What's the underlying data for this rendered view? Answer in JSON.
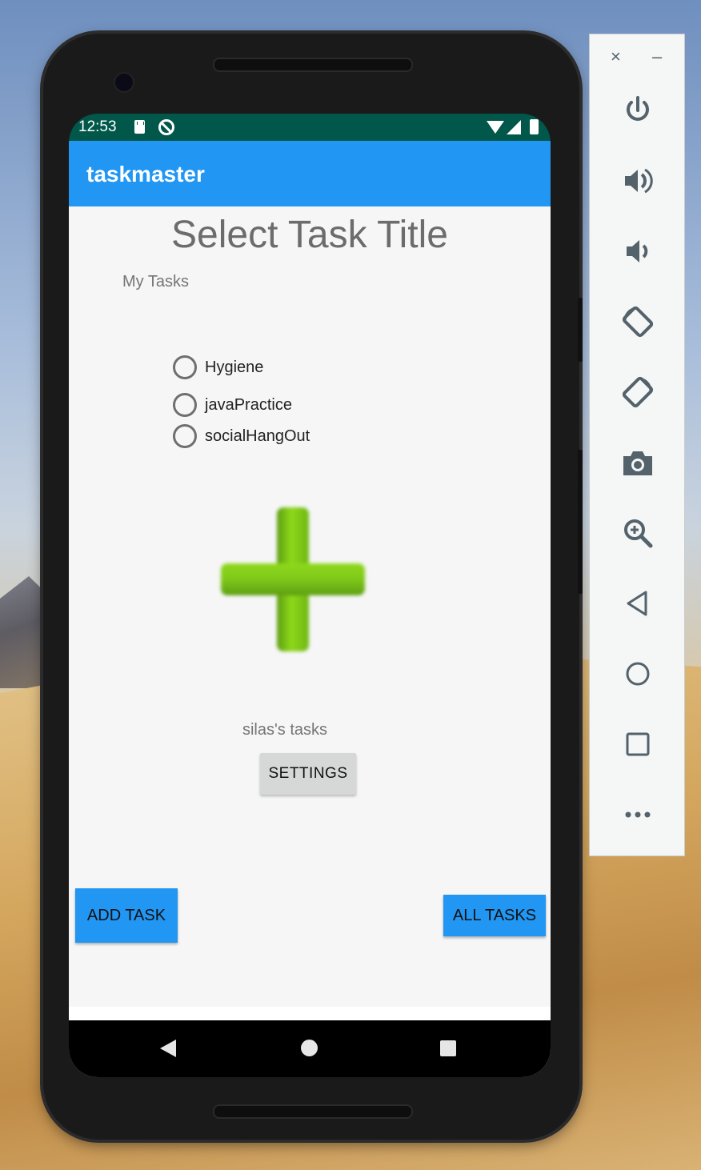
{
  "status_bar": {
    "time": "12:53"
  },
  "app_bar": {
    "title": "taskmaster"
  },
  "main": {
    "title": "Select Task Title",
    "subtitle": "My Tasks",
    "tasks": [
      {
        "label": "Hygiene",
        "checked": false
      },
      {
        "label": "javaPractice",
        "checked": false
      },
      {
        "label": "socialHangOut",
        "checked": false
      }
    ],
    "add_image_icon": "plus-icon",
    "owner_tasks_label": "silas's tasks",
    "settings_label": "SETTINGS",
    "add_task_label": "ADD TASK",
    "all_tasks_label": "ALL TASKS"
  },
  "colors": {
    "status_bar": "#01574a",
    "app_bar": "#2196f3",
    "button_primary": "#2196f3",
    "button_secondary": "#d6d7d7"
  },
  "nav_bar": {
    "icons": [
      "back-icon",
      "home-icon",
      "recents-icon"
    ]
  },
  "emulator_panel": {
    "close_glyph": "×",
    "minimize_glyph": "–",
    "controls": [
      "power-icon",
      "volume-up-icon",
      "volume-down-icon",
      "rotate-left-icon",
      "rotate-right-icon",
      "camera-icon",
      "zoom-icon",
      "back-icon",
      "home-icon",
      "overview-icon",
      "more-icon"
    ]
  }
}
